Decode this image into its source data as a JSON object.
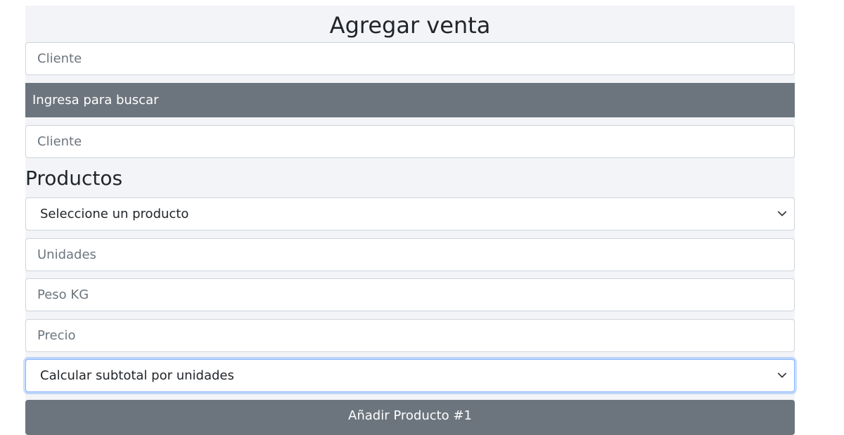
{
  "form": {
    "title": "Agregar venta",
    "client_input": {
      "placeholder": "Cliente",
      "value": ""
    },
    "search_label": "Ingresa para buscar",
    "client_field_2": {
      "placeholder": "Cliente",
      "value": ""
    }
  },
  "products": {
    "section_title": "Productos",
    "product_select": {
      "selected": "Seleccione un producto"
    },
    "units_input": {
      "placeholder": "Unidades"
    },
    "weight_input": {
      "placeholder": "Peso KG"
    },
    "price_input": {
      "placeholder": "Precio"
    },
    "subtotal_select": {
      "selected": "Calcular subtotal por unidades"
    },
    "add_button_label": "Añadir Producto #1"
  },
  "colors": {
    "panel_bg": "#f3f4f7",
    "secondary": "#6c757d",
    "focus_border": "#86b7fe"
  },
  "icons": {
    "select_arrow": "chevron-down-icon"
  }
}
